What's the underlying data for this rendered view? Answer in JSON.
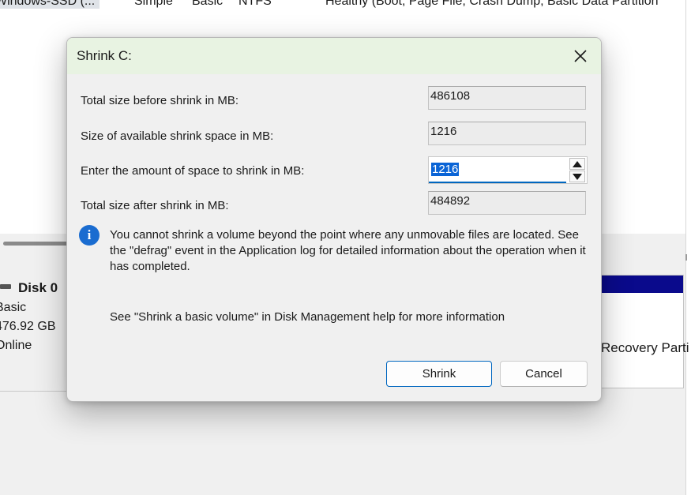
{
  "background": {
    "volume_row": {
      "name": "Windows-SSD (...",
      "layout": "Simple",
      "type": "Basic",
      "file_system": "NTFS",
      "status": "Healthy (Boot, Page File, Crash Dump, Basic Data Partition"
    },
    "disk": {
      "title": "Disk 0",
      "type": "Basic",
      "size": "476.92 GB",
      "status": "Online"
    },
    "partition_label": "Recovery Parti"
  },
  "dialog": {
    "title": "Shrink C:",
    "fields": {
      "total_before_label": "Total size before shrink in MB:",
      "total_before_value": "486108",
      "available_label": "Size of available shrink space in MB:",
      "available_value": "1216",
      "amount_label": "Enter the amount of space to shrink in MB:",
      "amount_value": "1216",
      "total_after_label": "Total size after shrink in MB:",
      "total_after_value": "484892"
    },
    "info_text": "You cannot shrink a volume beyond the point where any unmovable files are located. See the \"defrag\" event in the Application log for detailed information about the operation when it has completed.",
    "help_text": "See \"Shrink a basic volume\" in Disk Management help for more information",
    "buttons": {
      "shrink": "Shrink",
      "cancel": "Cancel"
    },
    "icons": {
      "close": "close-icon",
      "info": "info-icon",
      "spin_up": "spin-up-icon",
      "spin_down": "spin-down-icon"
    },
    "colors": {
      "titlebar": "#e8f3e2",
      "accent": "#0067c0",
      "selection": "#0a64d6"
    }
  }
}
